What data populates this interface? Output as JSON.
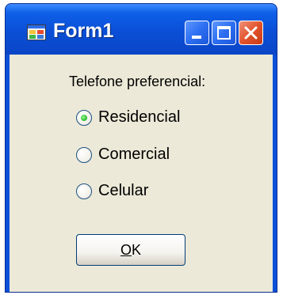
{
  "window": {
    "title": "Form1",
    "buttons": {
      "minimize": "minimize-icon",
      "maximize": "maximize-icon",
      "close": "close-icon"
    }
  },
  "form": {
    "group_label": "Telefone preferencial:",
    "options": [
      {
        "label": "Residencial",
        "selected": true
      },
      {
        "label": "Comercial",
        "selected": false
      },
      {
        "label": "Celular",
        "selected": false
      }
    ],
    "ok_mnemonic": "O",
    "ok_rest": "K"
  },
  "colors": {
    "titlebar": "#0a4fd6",
    "client_bg": "#ece9d8",
    "close_button": "#e2532c",
    "radio_selected": "#37c937"
  }
}
